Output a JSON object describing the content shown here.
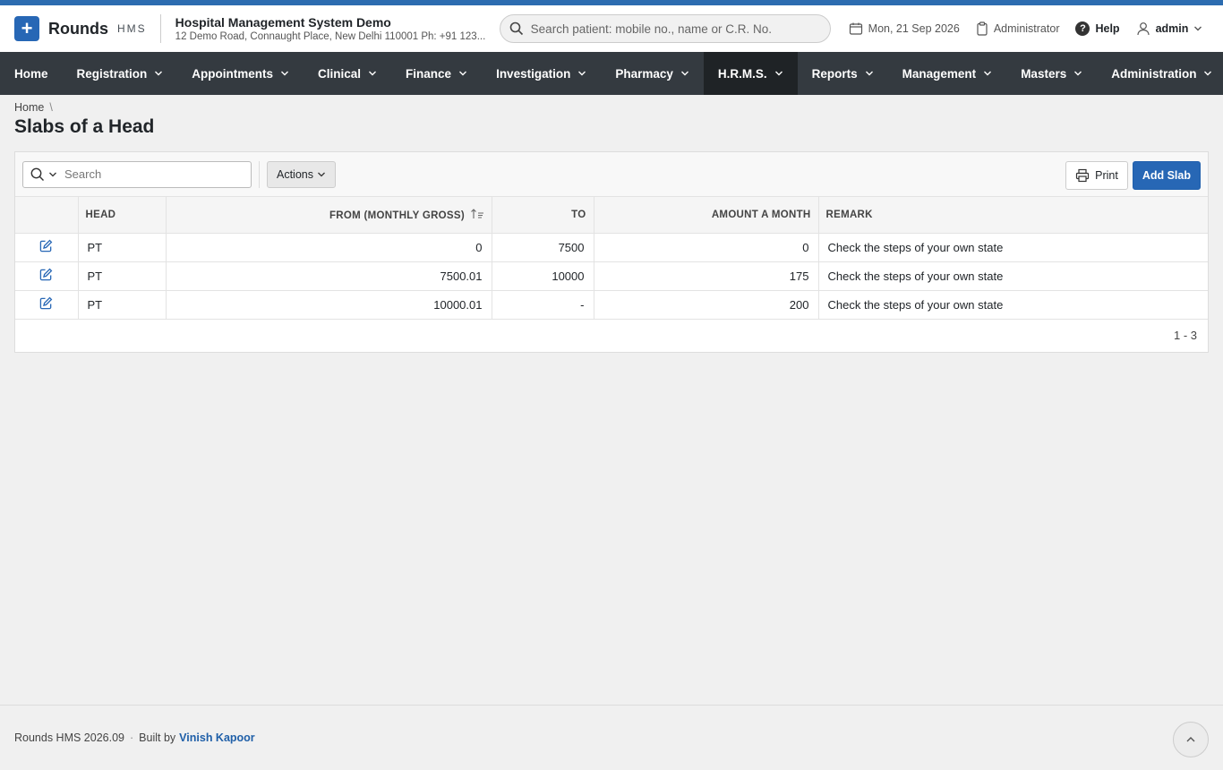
{
  "brand": {
    "name": "Rounds",
    "sub": "HMS",
    "logo_icon": "plus-icon",
    "accent": "#2767b5"
  },
  "hospital": {
    "name": "Hospital Management System Demo",
    "address": "12 Demo Road, Connaught Place, New Delhi 110001 Ph: +91 123..."
  },
  "search": {
    "placeholder": "Search patient: mobile no., name or C.R. No."
  },
  "header": {
    "date": "Mon, 21 Sep 2026",
    "role": "Administrator",
    "help": "Help",
    "user": "admin"
  },
  "nav": {
    "items": [
      {
        "label": "Home",
        "dropdown": false,
        "active": false
      },
      {
        "label": "Registration",
        "dropdown": true,
        "active": false
      },
      {
        "label": "Appointments",
        "dropdown": true,
        "active": false
      },
      {
        "label": "Clinical",
        "dropdown": true,
        "active": false
      },
      {
        "label": "Finance",
        "dropdown": true,
        "active": false
      },
      {
        "label": "Investigation",
        "dropdown": true,
        "active": false
      },
      {
        "label": "Pharmacy",
        "dropdown": true,
        "active": false
      },
      {
        "label": "H.R.M.S.",
        "dropdown": true,
        "active": true
      },
      {
        "label": "Reports",
        "dropdown": true,
        "active": false
      },
      {
        "label": "Management",
        "dropdown": true,
        "active": false
      },
      {
        "label": "Masters",
        "dropdown": true,
        "active": false
      },
      {
        "label": "Administration",
        "dropdown": true,
        "active": false
      }
    ]
  },
  "breadcrumb": {
    "home": "Home",
    "sep": "\\"
  },
  "page": {
    "title": "Slabs of a Head"
  },
  "toolbar": {
    "search_placeholder": "Search",
    "actions_label": "Actions",
    "print_label": "Print",
    "add_label": "Add Slab"
  },
  "table": {
    "columns": [
      "Head",
      "From (Monthly Gross)",
      "To",
      "Amount a Month",
      "Remark"
    ],
    "rows": [
      {
        "head": "PT",
        "from": "0",
        "to": "7500",
        "amount": "0",
        "remark": "Check the steps of your own state"
      },
      {
        "head": "PT",
        "from": "7500.01",
        "to": "10000",
        "amount": "175",
        "remark": "Check the steps of your own state"
      },
      {
        "head": "PT",
        "from": "10000.01",
        "to": "-",
        "amount": "200",
        "remark": "Check the steps of your own state"
      }
    ],
    "pagination": "1 - 3"
  },
  "footer": {
    "version": "Rounds HMS 2026.09",
    "built_by_label": "Built by",
    "author": "Vinish Kapoor"
  }
}
